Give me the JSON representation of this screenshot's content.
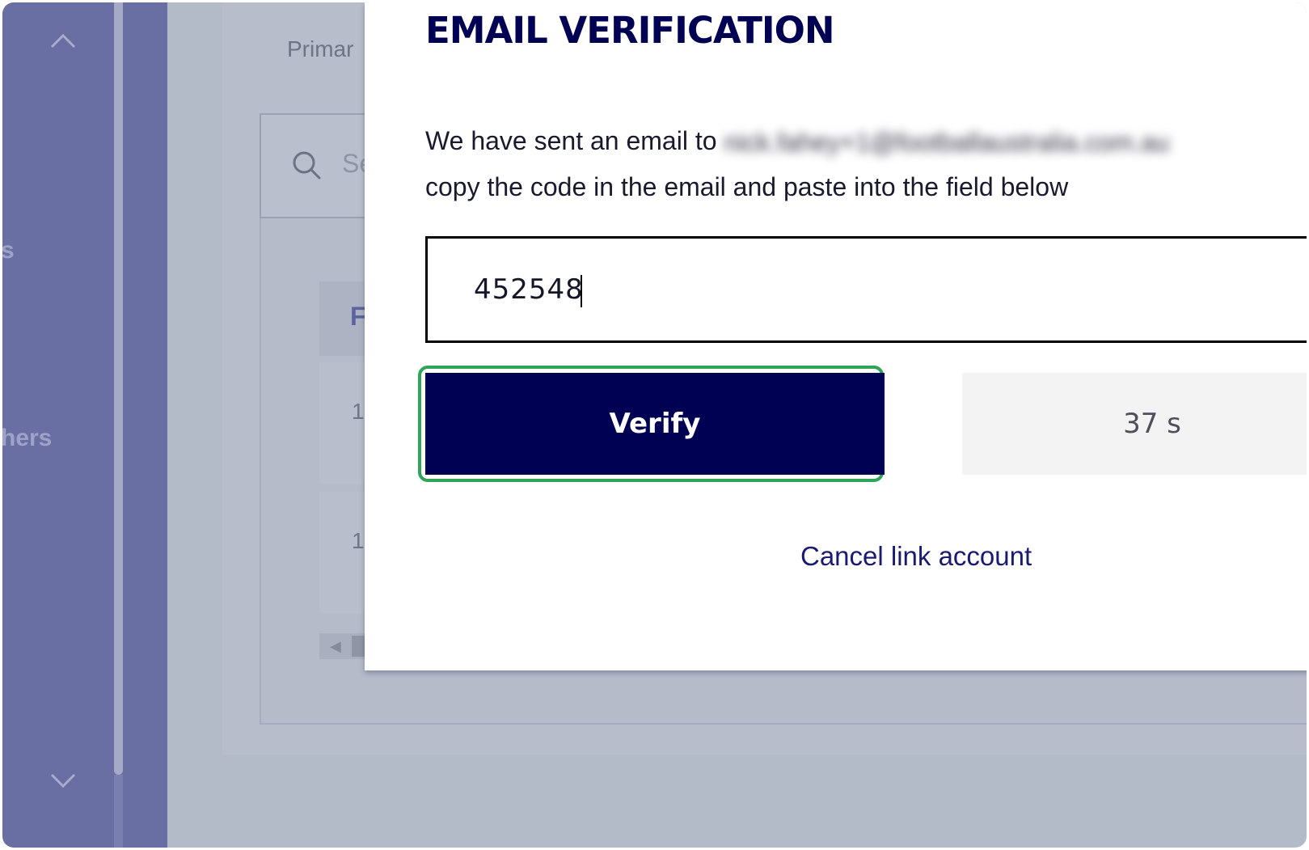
{
  "background": {
    "sidebar": {
      "fragment_1": "s",
      "fragment_2": "hers"
    },
    "primary_label": "Primar",
    "search_placeholder": "Se",
    "table_header_fragment": "F",
    "row_1_fragment": "1",
    "row_2_fragment": "1"
  },
  "modal": {
    "title": "EMAIL VERIFICATION",
    "message_prefix": "We have sent an email to",
    "email_redacted": "nick.fahey+1@footballaustralia.com.au",
    "message_suffix": "copy the code in the email and paste into the field below",
    "code_value": "452548",
    "verify_label": "Verify",
    "resend_timer": "37 s",
    "cancel_label": "Cancel link account"
  },
  "colors": {
    "brand_navy": "#010154",
    "highlight_green": "#2ea55a",
    "sidebar_purple": "#6a6fa3"
  },
  "icons": {
    "sidebar_up": "chevron-up-icon",
    "sidebar_down": "chevron-down-icon",
    "search": "search-icon"
  }
}
